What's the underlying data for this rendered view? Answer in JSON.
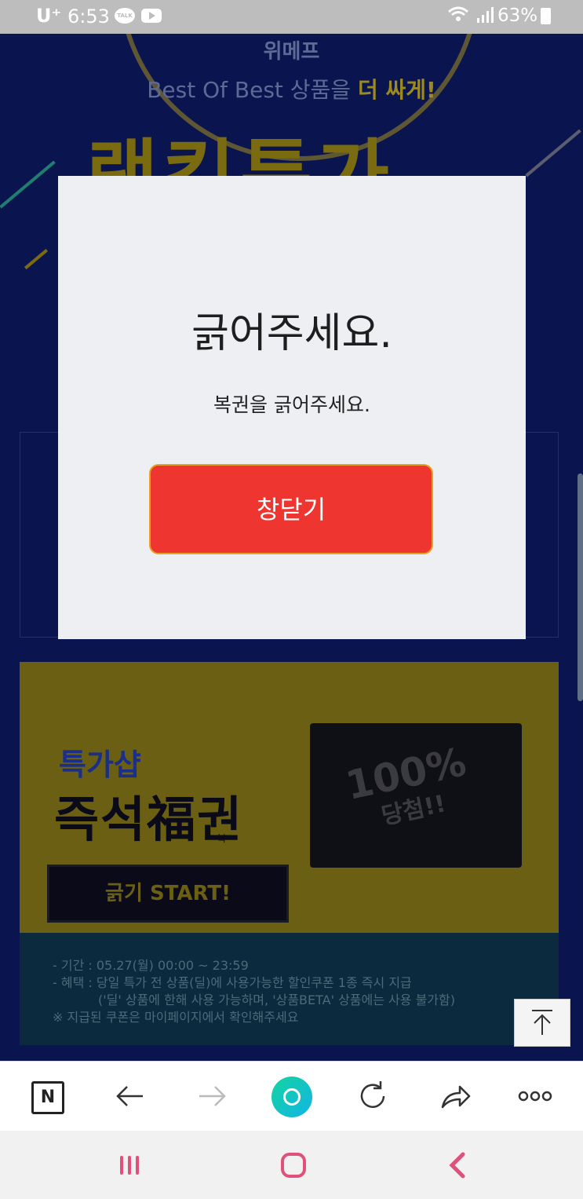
{
  "status_bar": {
    "carrier": "U⁺",
    "time": "6:53",
    "talk_badge": "TALK",
    "battery": "63%",
    "icons": [
      "talk-icon",
      "youtube-icon",
      "wifi-icon",
      "signal-icon",
      "battery-icon"
    ]
  },
  "page": {
    "brand": "위메프",
    "tagline_prefix": "Best Of Best 상품을 ",
    "tagline_emph": "더 싸게!",
    "headline": "랭킹특가",
    "promo": {
      "shop_label": "특가샵",
      "coupon_title": "즉석福권",
      "coupon_small": "복",
      "start_label": "긁기 START!",
      "ticket_big": "100%",
      "ticket_small": "당첨!!",
      "info": [
        "- 기간 : 05.27(월) 00:00 ~ 23:59",
        "- 혜택 : 당일 특가 전 상품(딜)에 사용가능한 할인쿠폰 1종 즉시 지급",
        "('딜' 상품에 한해 사용 가능하며, '상품BETA' 상품에는 사용 불가함)",
        "※ 지급된 쿠폰은 마이페이지에서 확인해주세요"
      ]
    }
  },
  "modal": {
    "title": "긁어주세요.",
    "message": "복권을 긁어주세요.",
    "close_label": "창닫기",
    "close_color": "#ef3530"
  },
  "toolbar": {
    "n_label": "N",
    "icons": [
      "naver-n-icon",
      "back-arrow-icon",
      "forward-arrow-icon",
      "home-icon",
      "refresh-icon",
      "share-icon",
      "more-icon"
    ],
    "home_accent": "#14d4a0"
  },
  "system_nav": {
    "icons": [
      "recent-apps-icon",
      "home-button-icon",
      "back-button-icon"
    ],
    "accent": "#e0507a"
  }
}
